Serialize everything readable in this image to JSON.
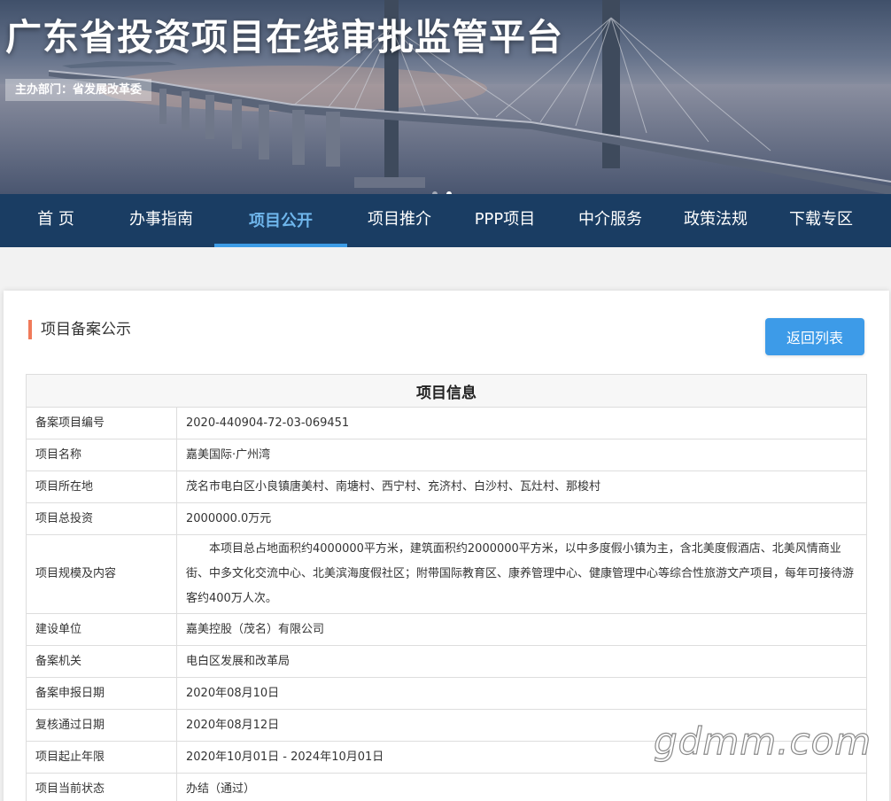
{
  "banner": {
    "title": "广东省投资项目在线审批监管平台",
    "sponsor": "主办部门：省发展改革委"
  },
  "nav": {
    "items": [
      {
        "label": "首 页"
      },
      {
        "label": "办事指南"
      },
      {
        "label": "项目公开",
        "active": true
      },
      {
        "label": "项目推介"
      },
      {
        "label": "PPP项目"
      },
      {
        "label": "中介服务"
      },
      {
        "label": "政策法规"
      },
      {
        "label": "下载专区"
      }
    ]
  },
  "panel": {
    "title": "项目备案公示",
    "back_button": "返回列表"
  },
  "table": {
    "header": "项目信息",
    "rows": [
      {
        "label": "备案项目编号",
        "value": "2020-440904-72-03-069451"
      },
      {
        "label": "项目名称",
        "value": "嘉美国际·广州湾"
      },
      {
        "label": "项目所在地",
        "value": "茂名市电白区小良镇唐美村、南塘村、西宁村、充济村、白沙村、瓦灶村、那梭村"
      },
      {
        "label": "项目总投资",
        "value": "2000000.0万元"
      },
      {
        "label": "项目规模及内容",
        "value": "本项目总占地面积约4000000平方米，建筑面积约2000000平方米，以中多度假小镇为主，含北美度假酒店、北美风情商业街、中多文化交流中心、北美滨海度假社区；附带国际教育区、康养管理中心、健康管理中心等综合性旅游文产项目，每年可接待游客约400万人次。"
      },
      {
        "label": "建设单位",
        "value": "嘉美控股（茂名）有限公司"
      },
      {
        "label": "备案机关",
        "value": "电白区发展和改革局"
      },
      {
        "label": "备案申报日期",
        "value": "2020年08月10日"
      },
      {
        "label": "复核通过日期",
        "value": "2020年08月12日"
      },
      {
        "label": "项目起止年限",
        "value": "2020年10月01日 - 2024年10月01日"
      },
      {
        "label": "项目当前状态",
        "value": "办结（通过）"
      }
    ]
  },
  "watermark": "gdmm.com",
  "colors": {
    "nav_bg": "#1a3d63",
    "nav_active": "#6fb6ec",
    "button_bg": "#3d9be8",
    "title_accent": "#f07a5a"
  }
}
